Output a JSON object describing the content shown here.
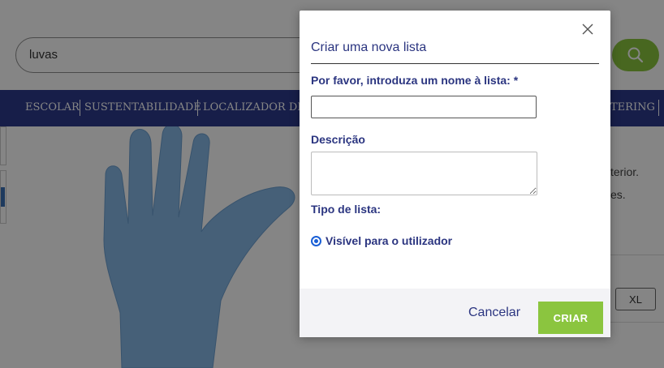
{
  "search": {
    "value": "luvas"
  },
  "nav": {
    "items": [
      "ESCOLAR",
      "SUSTENTABILIDADE",
      "LOCALIZADOR DE",
      "TERING"
    ]
  },
  "background_text": {
    "line1": "terior.",
    "line2": "es.",
    "size_option": "XL"
  },
  "modal": {
    "title": "Criar uma nova lista",
    "name_label": "Por favor, introduza um nome à lista: *",
    "name_value": "",
    "description_label": "Descrição",
    "description_value": "",
    "list_type_label": "Tipo de lista:",
    "visibility_option": "Visível para o utilizador",
    "cancel_label": "Cancelar",
    "create_label": "CRIAR"
  },
  "colors": {
    "brand_navy": "#2d3a8c",
    "accent_green": "#8bc53f",
    "text_navy": "#2b3580"
  },
  "icons": {
    "search": "search-icon",
    "close": "close-icon"
  }
}
